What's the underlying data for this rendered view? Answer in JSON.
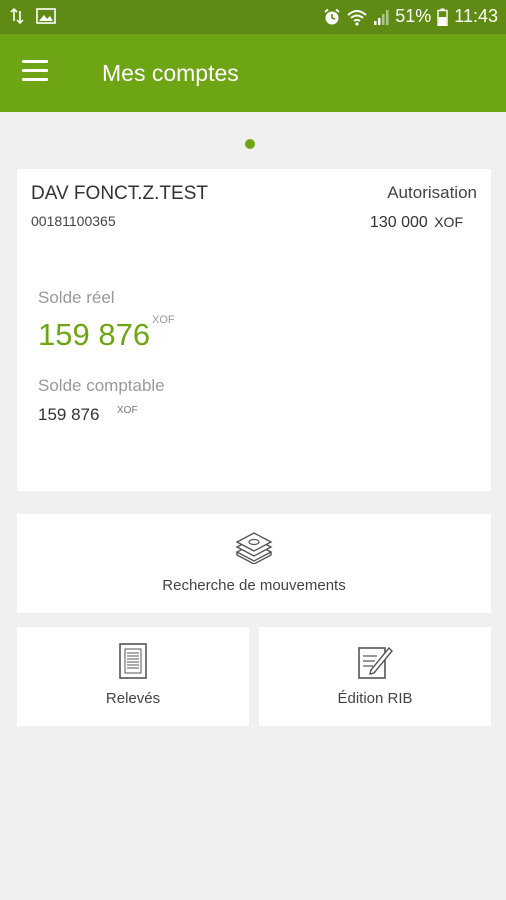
{
  "status_bar": {
    "battery": "51%",
    "time": "11:43"
  },
  "header": {
    "title": "Mes comptes"
  },
  "account": {
    "name": "DAV FONCT.Z.TEST",
    "number": "00181100365",
    "authorization_label": "Autorisation",
    "authorization_amount": "130 000",
    "authorization_currency": "XOF",
    "real_balance_label": "Solde réel",
    "real_balance_value": "159 876",
    "real_balance_currency": "XOF",
    "accounting_balance_label": "Solde comptable",
    "accounting_balance_value": "159 876",
    "accounting_balance_currency": "XOF"
  },
  "actions": {
    "search_movements": "Recherche de mouvements",
    "statements": "Relevés",
    "rib": "Édition RIB"
  },
  "colors": {
    "status_bar": "#5f8a14",
    "app_bar": "#6ea515",
    "accent_green": "#6ea515",
    "background": "#f0f0f0"
  },
  "icons": [
    "usb-transfer-icon",
    "image-icon",
    "alarm-icon",
    "wifi-icon",
    "signal-icon",
    "battery-icon",
    "hamburger-menu-icon",
    "money-stack-icon",
    "document-icon",
    "edit-document-icon"
  ]
}
